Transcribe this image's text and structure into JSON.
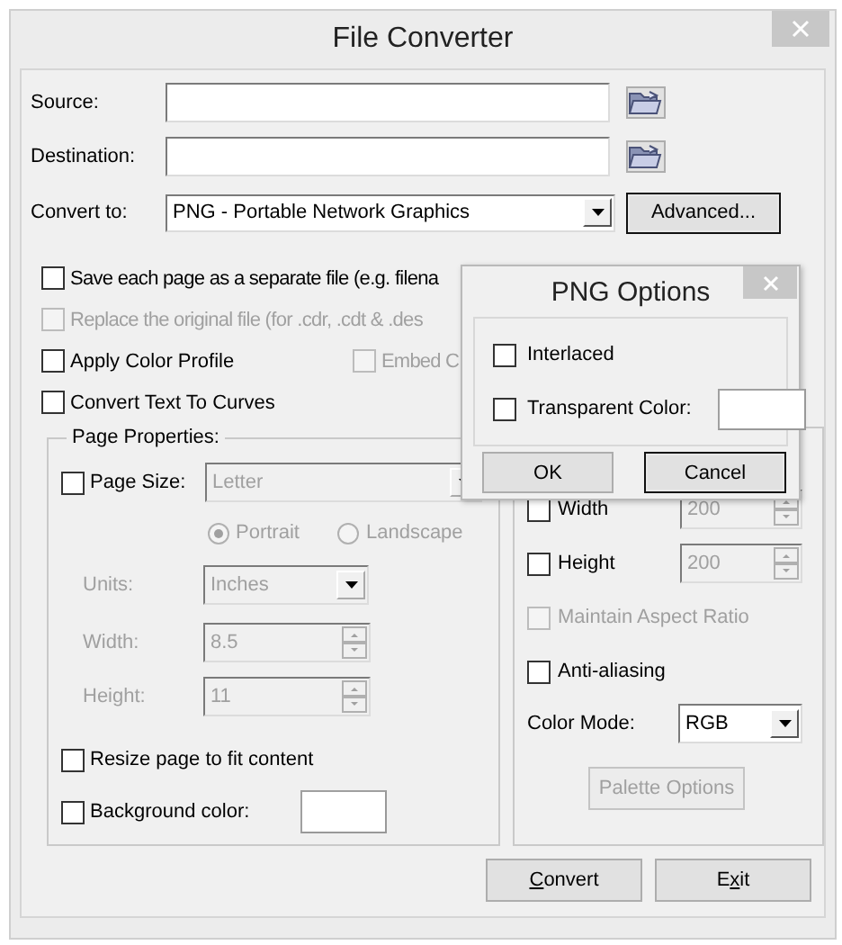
{
  "window": {
    "title": "File Converter"
  },
  "paths": [
    {
      "label": "Source:"
    },
    {
      "label": "Destination:"
    }
  ],
  "convert_to": {
    "label": "Convert to:",
    "value": "PNG - Portable Network Graphics"
  },
  "advanced_button": {
    "label": "Advanced...",
    "default": true
  },
  "options": [
    {
      "label": "Save each page as a separate file (e.g. filena",
      "checked": false,
      "disabled": false
    },
    {
      "label": "Replace the original file (for .cdr, .cdt & .des",
      "checked": false,
      "disabled": true
    },
    {
      "label": "Apply Color Profile",
      "checked": false,
      "disabled": false
    },
    {
      "label": "Convert Text To Curves",
      "checked": false,
      "disabled": false
    }
  ],
  "embed_option": {
    "label": "Embed C",
    "checked": false,
    "disabled": true
  },
  "page_properties": {
    "title": "Page Properties:",
    "page_size": {
      "label": "Page Size:",
      "checked": false,
      "value": "Letter",
      "disabled": true
    },
    "orientation": [
      {
        "label": "Portrait",
        "selected": true
      },
      {
        "label": "Landscape",
        "selected": false
      }
    ],
    "units": {
      "label": "Units:",
      "value": "Inches",
      "disabled": true
    },
    "width": {
      "label": "Width:",
      "value": "8.5",
      "disabled": true
    },
    "height": {
      "label": "Height:",
      "value": "11",
      "disabled": true
    },
    "resize": {
      "label": "Resize page to fit content",
      "checked": false,
      "disabled": false
    },
    "background": {
      "label": "Background color:",
      "checked": false,
      "disabled": false
    }
  },
  "bitmap": {
    "width": {
      "label": "Width",
      "checked": false,
      "value": "200",
      "disabled": false,
      "field_disabled": true
    },
    "height": {
      "label": "Height",
      "checked": false,
      "value": "200",
      "disabled": false,
      "field_disabled": true
    },
    "maintain": {
      "label": "Maintain Aspect Ratio",
      "checked": false,
      "disabled": true
    },
    "antialias": {
      "label": "Anti-aliasing",
      "checked": false,
      "disabled": false
    },
    "color_mode": {
      "label": "Color Mode:",
      "value": "RGB"
    },
    "palette_button": {
      "label": "Palette Options",
      "disabled": true
    }
  },
  "buttons": [
    {
      "accel": "C",
      "post": "onvert"
    },
    {
      "pre": "E",
      "accel": "x",
      "post": "it"
    }
  ],
  "popup": {
    "title": "PNG Options",
    "options": [
      {
        "kind": "check",
        "label": "Interlaced",
        "checked": false
      },
      {
        "kind": "color",
        "label": "Transparent Color:",
        "checked": false
      }
    ],
    "buttons": [
      {
        "label": "OK",
        "default": false
      },
      {
        "label": "Cancel",
        "default": true
      }
    ]
  }
}
